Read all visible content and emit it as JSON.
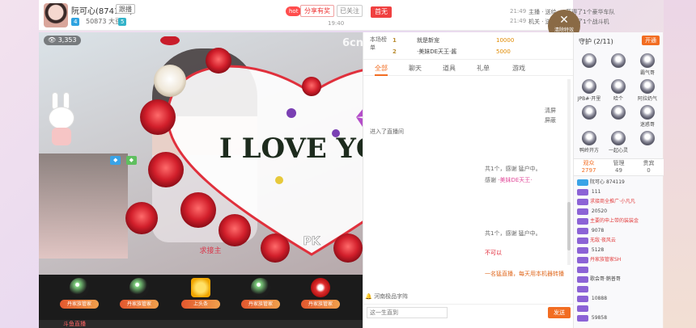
{
  "header": {
    "host_name": "阮可心(874119)",
    "follow_label": "跟播",
    "level": "4",
    "bean_count": "50873 大豆",
    "fans_level": "5",
    "hot_label": "hot",
    "share_label": "分享有奖",
    "followed_label": "已关注",
    "stream_time": "19:40",
    "trigger_tag": "首无",
    "broadcasts": [
      {
        "time": "21:49",
        "text": "主播 · 送给 一 获得了1个豪华车队"
      },
      {
        "time": "21:49",
        "text": "机关 · 送给 一 获得了1个战斗机"
      }
    ],
    "clear_fx_label": "清除特效"
  },
  "video": {
    "viewer_count": "3,353",
    "logo_text": "6cn",
    "overlay_text": "I LOVE YOU",
    "fx_caption": "求接主",
    "fx_tag": "PK"
  },
  "gifts": [
    {
      "label": "丹家族管家"
    },
    {
      "label": "丹家族管家"
    },
    {
      "label": "上头条"
    },
    {
      "label": "丹家族管家"
    },
    {
      "label": "丹家族管家"
    }
  ],
  "bottom_bar": {
    "logo": "斗鱼直播"
  },
  "chat": {
    "rank_title": "本场榜单",
    "rank": [
      {
        "no": "1",
        "name": "就是新宠",
        "value": "10000"
      },
      {
        "no": "2",
        "name": "·美妹DE天王·酱",
        "value": "5000"
      }
    ],
    "tabs": [
      "全部",
      "聊天",
      "道具",
      "礼单",
      "游戏"
    ],
    "report_label": "清屏",
    "pause_label": "屏蔽",
    "lines": [
      {
        "user": "",
        "text": ""
      },
      {
        "user": "",
        "text": "进入了直播间"
      },
      {
        "user": "",
        "text": "共1个，感谢 猛户中。"
      },
      {
        "user": "·美妹DE天王·",
        "text": "感谢"
      },
      {
        "user": "",
        "text": "共1个，感谢 猛户中。"
      },
      {
        "user": "",
        "text": "不可以"
      },
      {
        "user": "",
        "text": "一名猛直播，每天用本机器转播"
      }
    ],
    "flower_placeholder": "",
    "composer_hint": "河南极品字阵",
    "input_placeholder": "这一生直到",
    "send_label": "发送",
    "bottom_hint": ""
  },
  "right": {
    "guard_title": "守护 (2/11)",
    "guard_btn": "开通",
    "guards": [
      {
        "name": ""
      },
      {
        "name": ""
      },
      {
        "name": "霸气哥"
      },
      {
        "name": "JPB#·开里"
      },
      {
        "name": "哈个"
      },
      {
        "name": "阿拉奶气"
      },
      {
        "name": ""
      },
      {
        "name": ""
      },
      {
        "name": "迷惑哥"
      },
      {
        "name": "鸭岭开方"
      },
      {
        "name": "一起心灵"
      },
      {
        "name": ""
      }
    ],
    "aud_tabs": [
      {
        "label": "观众",
        "count": "2797"
      },
      {
        "label": "管理",
        "count": "49"
      },
      {
        "label": "贵宾",
        "count": "0"
      }
    ],
    "audience": [
      {
        "name": "阮可心",
        "value": "874119"
      },
      {
        "name": "",
        "value": "111"
      },
      {
        "name": "求接商全推广·小凡凡",
        "value": ""
      },
      {
        "name": "",
        "value": "20520"
      },
      {
        "name": "主要的申上带的装装金",
        "value": ""
      },
      {
        "name": "",
        "value": "9078"
      },
      {
        "name": "无敌·夜风云",
        "value": ""
      },
      {
        "name": "",
        "value": "5128"
      },
      {
        "name": "丹家族管家SH",
        "value": ""
      },
      {
        "name": "",
        "value": ""
      },
      {
        "name": "歌会哥·鹅普哥",
        "value": ""
      },
      {
        "name": "",
        "value": ""
      },
      {
        "name": "",
        "value": "10888"
      },
      {
        "name": "",
        "value": ""
      },
      {
        "name": "",
        "value": "59858"
      }
    ]
  }
}
